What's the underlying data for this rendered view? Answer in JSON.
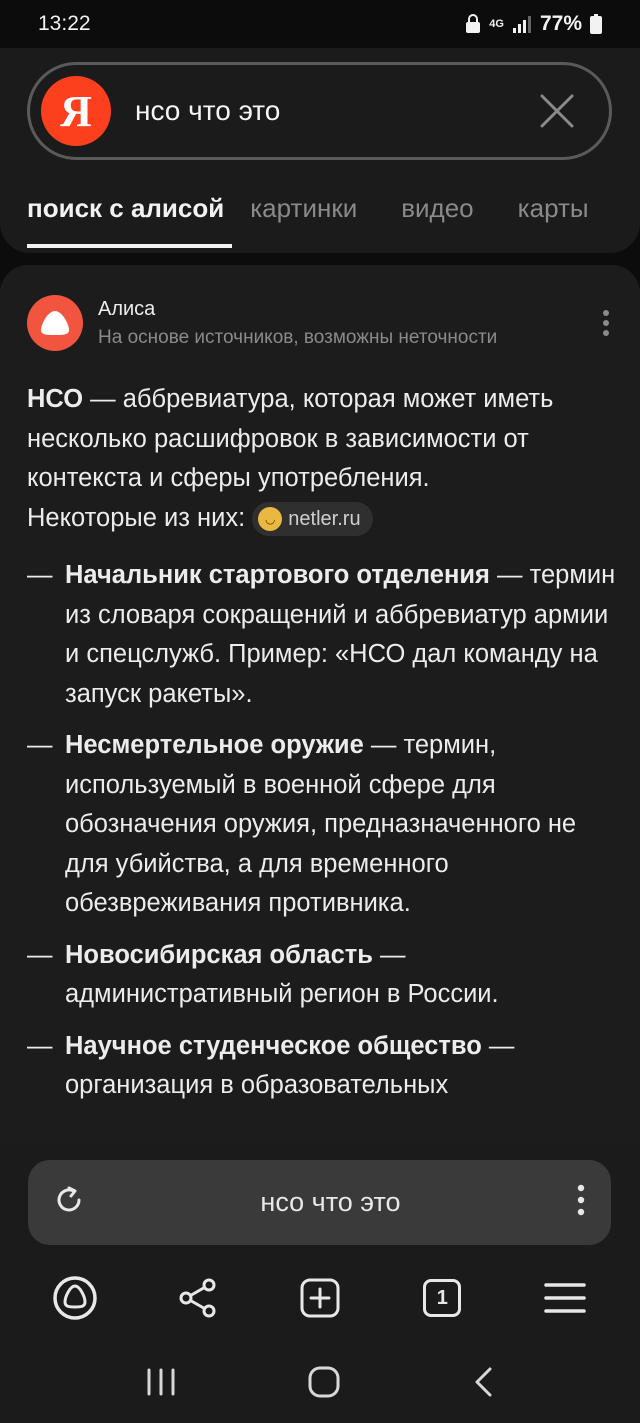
{
  "status": {
    "time": "13:22",
    "network": "4G",
    "battery": "77%"
  },
  "search": {
    "query": "нсо что это",
    "logo_letter": "Я",
    "tabs": [
      {
        "label": "поиск с алисой",
        "active": true
      },
      {
        "label": "картинки"
      },
      {
        "label": "видео"
      },
      {
        "label": "карты"
      }
    ]
  },
  "alice": {
    "name": "Алиса",
    "note": "На основе источников, возможны неточности",
    "intro_term": "НСО",
    "intro_line1": " — аббревиатура, которая может иметь",
    "intro_line2": "несколько расшифровок в зависимости от",
    "intro_line3": "контекста и сферы употребления.",
    "intro_line4": "Некоторые из них:",
    "source_chip": "netler.ru",
    "items": [
      {
        "term": "Начальник стартового отделения",
        "rest": " — термин из словаря сокращений и аббревиатур армии и спецслужб. Пример: «НСО дал команду на запуск ракеты»."
      },
      {
        "term": "Несмертельное оружие",
        "rest": " — термин, используемый в военной сфере для обозначения оружия, предназначенного не для убийства, а для временного обезвреживания противника."
      },
      {
        "term": "Новосибирская область",
        "rest": " — административный регион в России."
      },
      {
        "term": "Научное студенческое общество",
        "rest": " — организация в образовательных"
      }
    ]
  },
  "bottom": {
    "url_text": "нсо что это",
    "tabs_count": "1"
  },
  "colors": {
    "yandex_red": "#fc3f1d",
    "alice_orange": "#f1553f",
    "background": "#0c0c0c",
    "card": "#1c1c1c"
  }
}
